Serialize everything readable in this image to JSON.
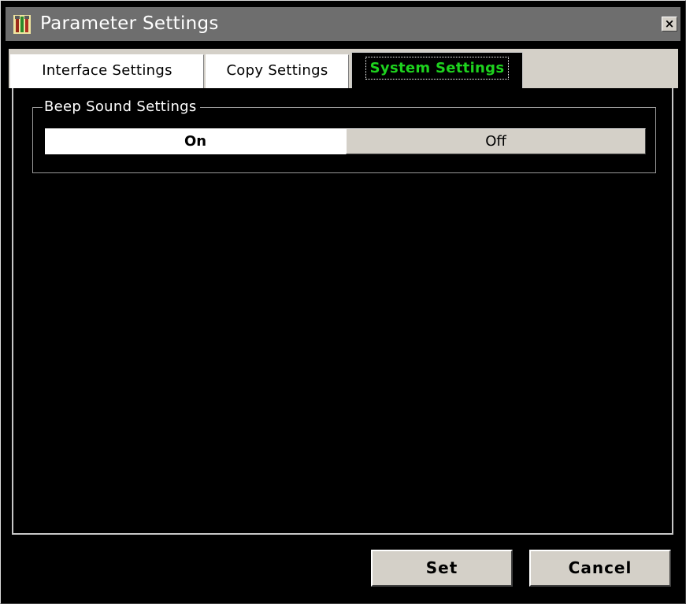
{
  "window": {
    "title": "Parameter Settings",
    "close_glyph": "×",
    "icon": "tools-icon"
  },
  "tabs": [
    {
      "label": "Interface Settings",
      "active": false
    },
    {
      "label": "Copy Settings",
      "active": false
    },
    {
      "label": "System Settings",
      "active": true
    }
  ],
  "beep": {
    "group_label": "Beep Sound Settings",
    "on_label": "On",
    "off_label": "Off",
    "selected": "On"
  },
  "footer": {
    "set_label": "Set",
    "cancel_label": "Cancel"
  },
  "colors": {
    "titlebar": "#6e6e6e",
    "panel_background": "#000000",
    "active_tab_text": "#1ed21e",
    "button_face": "#d4d0c8"
  }
}
